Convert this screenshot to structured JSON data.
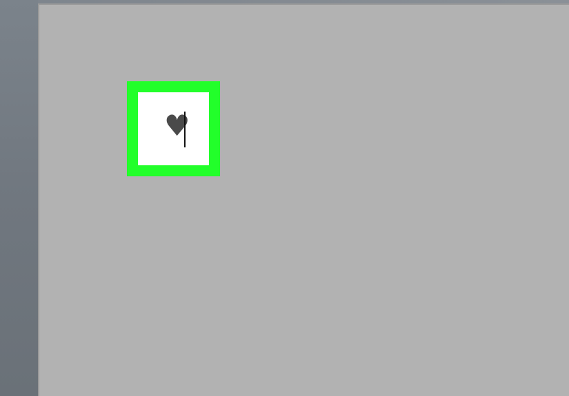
{
  "document": {
    "selected_symbol": "♥"
  },
  "colors": {
    "highlight": "#22ff2a",
    "page_background": "#b2b2b2",
    "workspace_background": "#737a82",
    "symbol_color": "#4a4a4a"
  },
  "icons": {
    "symbol_glyph": "heart-icon"
  }
}
